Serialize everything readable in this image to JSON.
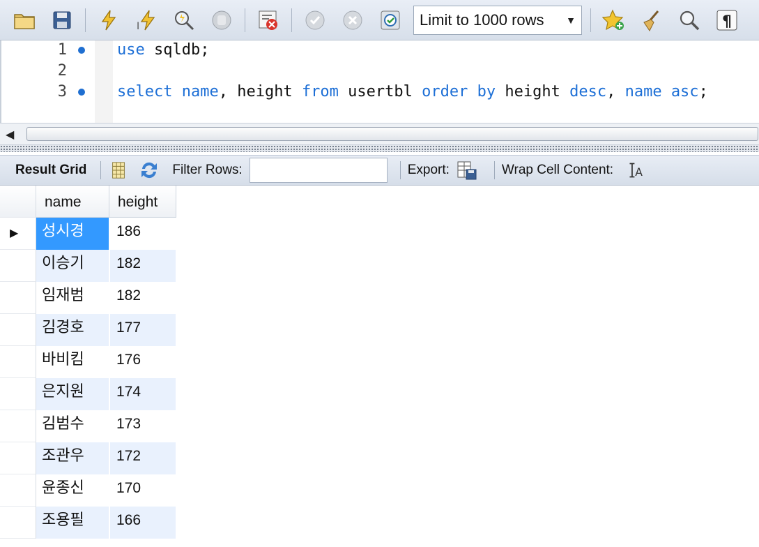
{
  "toolbar": {
    "icons": [
      "open-folder-icon",
      "save-icon",
      "execute-icon",
      "execute-current-icon",
      "explain-icon",
      "stop-icon",
      "toggle-error-icon",
      "commit-icon",
      "rollback-icon",
      "autocommit-icon",
      "limit-rows-select",
      "add-snippet-icon",
      "beautify-icon",
      "find-icon",
      "invisible-chars-icon"
    ],
    "limit_rows_label": "Limit to 1000 rows"
  },
  "editor": {
    "lines": [
      {
        "number": "1",
        "has_marker": true
      },
      {
        "number": "2",
        "has_marker": false
      },
      {
        "number": "3",
        "has_marker": true
      }
    ],
    "line1": {
      "kw1": "use",
      "rest": " sqldb;"
    },
    "line3": {
      "kw_select": "select",
      "kw_name": "name",
      "t1": ", height ",
      "kw_from": "from",
      "t2": " usertbl ",
      "kw_order": "order",
      "t3": " ",
      "kw_by": "by",
      "t4": " height ",
      "kw_desc": "desc",
      "t5": ", ",
      "kw_name2": "name",
      "t6": " ",
      "kw_asc": "asc",
      "t7": ";"
    }
  },
  "result_toolbar": {
    "result_grid_label": "Result Grid",
    "filter_rows_label": "Filter Rows:",
    "filter_value": "",
    "export_label": "Export:",
    "wrap_cell_label": "Wrap Cell Content:"
  },
  "grid": {
    "columns": [
      "name",
      "height"
    ],
    "rows": [
      {
        "name": "성시경",
        "height": "186"
      },
      {
        "name": "이승기",
        "height": "182"
      },
      {
        "name": "임재범",
        "height": "182"
      },
      {
        "name": "김경호",
        "height": "177"
      },
      {
        "name": "바비킴",
        "height": "176"
      },
      {
        "name": "은지원",
        "height": "174"
      },
      {
        "name": "김범수",
        "height": "173"
      },
      {
        "name": "조관우",
        "height": "172"
      },
      {
        "name": "윤종신",
        "height": "170"
      },
      {
        "name": "조용필",
        "height": "166"
      }
    ]
  },
  "colors": {
    "selection": "#3399ff",
    "keyword": "#1d6fd6",
    "alt_row": "#e9f1fd"
  }
}
